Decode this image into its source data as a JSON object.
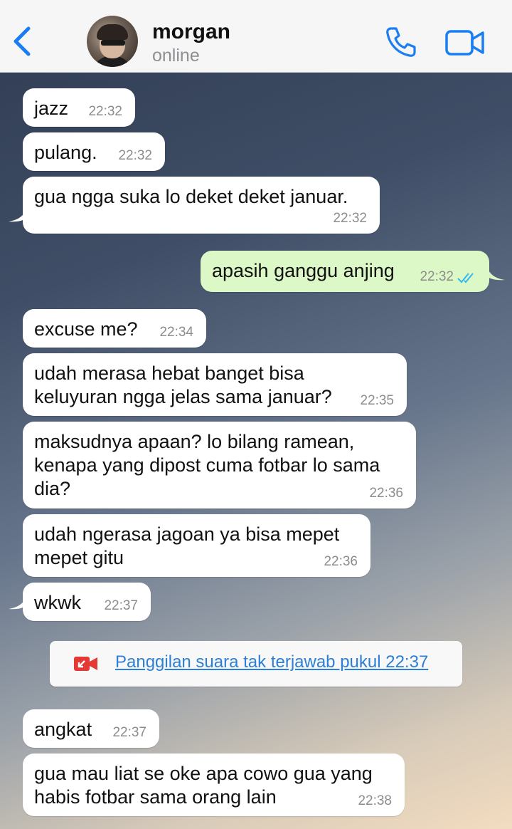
{
  "header": {
    "contact_name": "morgan",
    "contact_status": "online"
  },
  "messages": [
    {
      "dir": "in",
      "text": "jazz",
      "time": "22:32"
    },
    {
      "dir": "in",
      "text": "pulang.",
      "time": "22:32"
    },
    {
      "dir": "in",
      "text": "gua ngga suka lo deket deket januar.",
      "time": "22:32"
    },
    {
      "dir": "out",
      "text": "apasih ganggu anjing",
      "time": "22:32",
      "status": "read"
    },
    {
      "dir": "in",
      "text": "excuse me?",
      "time": "22:34"
    },
    {
      "dir": "in",
      "text": "udah merasa hebat banget bisa\nkeluyuran ngga jelas sama januar?",
      "time": "22:35"
    },
    {
      "dir": "in",
      "text": "maksudnya apaan? lo bilang ramean,\nkenapa yang dipost cuma fotbar lo sama\ndia?",
      "time": "22:36"
    },
    {
      "dir": "in",
      "text": "udah ngerasa jagoan ya bisa mepet\nmepet gitu",
      "time": "22:36"
    },
    {
      "dir": "in",
      "text": "wkwk",
      "time": "22:37"
    },
    {
      "dir": "in",
      "text": "angkat",
      "time": "22:37"
    },
    {
      "dir": "in",
      "text": "gua mau liat se oke apa cowo gua yang\nhabis fotbar sama orang lain",
      "time": "22:38"
    }
  ],
  "system_notice": {
    "text": "Panggilan suara tak terjawab pukul 22:37",
    "icon": "missed-video-call-icon"
  },
  "colors": {
    "accent": "#1a7ef2",
    "incoming_bubble": "#ffffff",
    "outgoing_bubble": "#dcf8c6",
    "read_ticks": "#34b7f1"
  }
}
